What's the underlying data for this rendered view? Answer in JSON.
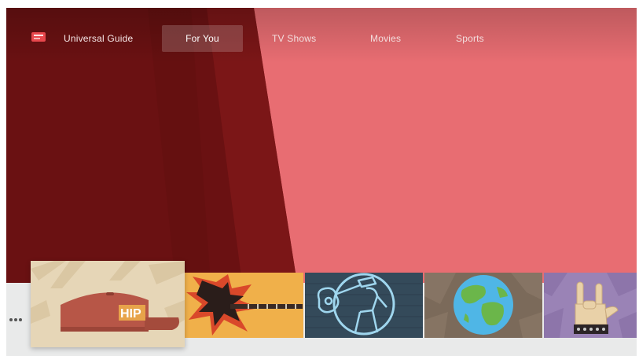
{
  "nav": {
    "items": [
      {
        "label": "Universal Guide"
      },
      {
        "label": "For You"
      },
      {
        "label": "TV Shows"
      },
      {
        "label": "Movies"
      },
      {
        "label": "Sports"
      }
    ],
    "active_index": 1
  },
  "tiles": [
    {
      "icon": "hip-hop-cap-icon",
      "text": "HIP"
    },
    {
      "icon": "electric-guitar-icon"
    },
    {
      "icon": "folk-guitarist-icon"
    },
    {
      "icon": "globe-icon"
    },
    {
      "icon": "rock-hand-icon"
    }
  ],
  "colors": {
    "hero_background": "#e86d72",
    "hero_dark_band": "#6a1112",
    "strip_background": "#e9eaea"
  }
}
